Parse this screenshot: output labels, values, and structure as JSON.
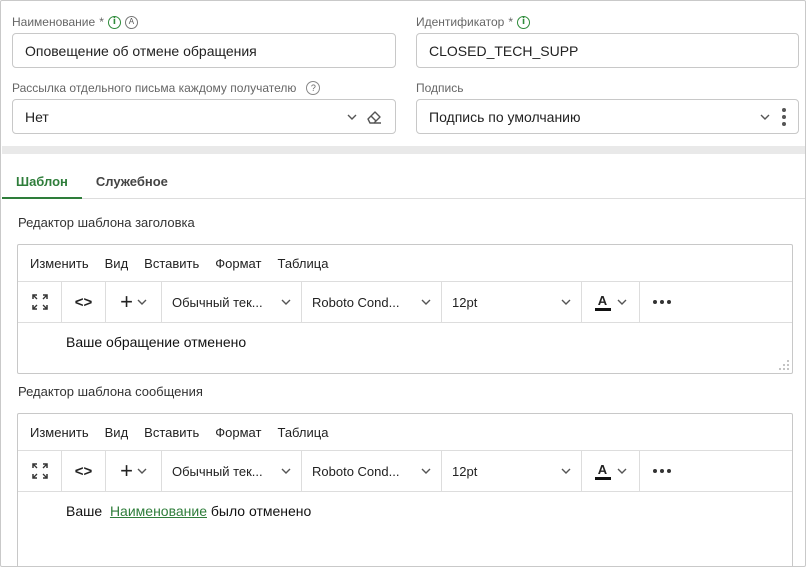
{
  "form": {
    "name": {
      "label": "Наименование",
      "required_mark": "*",
      "auto_icon_text": "A",
      "value": "Оповещение об отмене обращения"
    },
    "identifier": {
      "label": "Идентификатор",
      "required_mark": "*",
      "value": "CLOSED_TECH_SUPP"
    },
    "separate_mail": {
      "label": "Рассылка отдельного письма каждому получателю",
      "help_icon_text": "?",
      "value": "Нет"
    },
    "signature": {
      "label": "Подпись",
      "value": "Подпись по умолчанию"
    }
  },
  "tabs": [
    {
      "label": "Шаблон",
      "active": true
    },
    {
      "label": "Служебное",
      "active": false
    }
  ],
  "editor_labels": {
    "header_title": "Редактор шаблона заголовка",
    "message_title": "Редактор шаблона сообщения"
  },
  "editor_menu": [
    "Изменить",
    "Вид",
    "Вставить",
    "Формат",
    "Таблица"
  ],
  "editor_toolbar": {
    "code_glyph": "<>",
    "plus_glyph": "+",
    "paragraph_style": "Обычный тек...",
    "font_family": "Roboto Cond...",
    "font_size": "12pt",
    "color_glyph": "A"
  },
  "header_editor": {
    "content": "Ваше обращение отменено"
  },
  "message_editor": {
    "content_before": "Ваше",
    "content_link": "Наименование",
    "content_after": "было отменено"
  },
  "colors": {
    "accent": "#2e7d3a",
    "border": "#c8c8c8",
    "band": "#e9e9e9"
  },
  "icons": [
    "info-icon",
    "auto-icon",
    "help-icon",
    "chevron-down-icon",
    "eraser-icon",
    "kebab-icon",
    "fullscreen-icon",
    "code-icon",
    "plus-icon",
    "text-color-icon",
    "more-icon",
    "resize-handle-icon"
  ]
}
